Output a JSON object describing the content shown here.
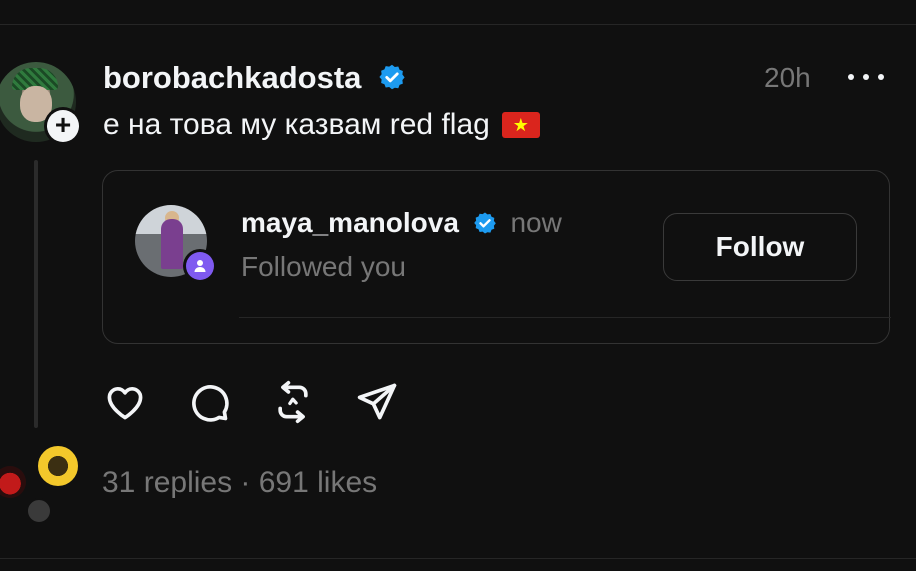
{
  "post": {
    "username": "borobachkadosta",
    "time": "20h",
    "text": "е на това му казвам red flag",
    "flag_glyph": "★",
    "colors": {
      "verified": "#1d9bf0",
      "flag_red": "#da251d",
      "flag_star": "#ffff00"
    }
  },
  "embedded_card": {
    "username": "maya_manolova",
    "time": "now",
    "subtitle": "Followed you",
    "follow_label": "Follow",
    "badge_color": "#7f5af0"
  },
  "actions": {
    "icons": [
      "heart-icon",
      "comment-icon",
      "repost-icon",
      "share-icon"
    ]
  },
  "stats": {
    "text": "31 replies · 691 likes"
  }
}
